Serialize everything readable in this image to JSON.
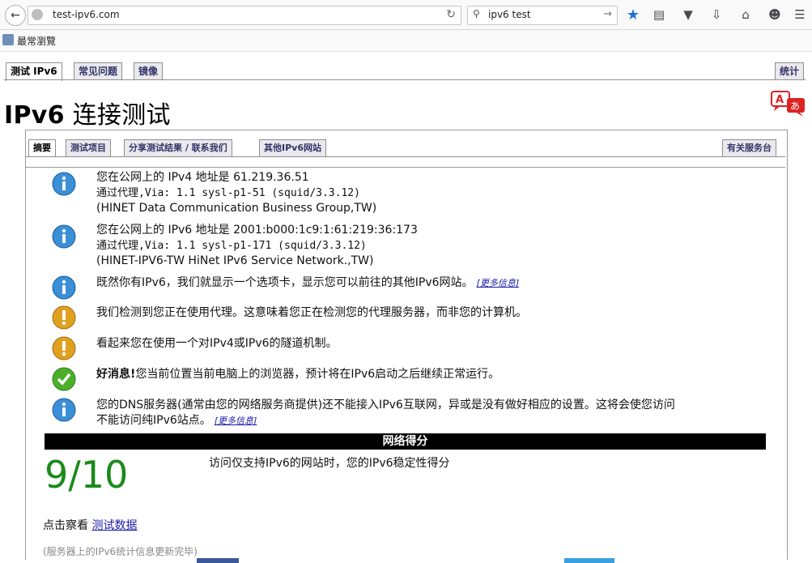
{
  "browser": {
    "url": "test-ipv6.com",
    "search_value": "ipv6 test",
    "bookmark_label": "最常瀏覽"
  },
  "page_tabs": [
    "测试 IPv6",
    "常见问题",
    "镜像"
  ],
  "stats_tab": "统计",
  "title": {
    "bold": "IPv6",
    "rest": " 连接测试"
  },
  "inner_tabs": [
    "摘要",
    "测试项目",
    "分享测试结果 / 联系我们",
    "其他IPv6网站"
  ],
  "service_tab": "有关服务台",
  "results": [
    {
      "icon": "info",
      "lines": [
        "您在公网上的 IPv4 地址是 61.219.36.51",
        "通过代理,Via: 1.1 sysl-p1-51 (squid/3.3.12)",
        "(HINET Data Communication Business Group,TW)"
      ]
    },
    {
      "icon": "info",
      "lines": [
        "您在公网上的 IPv6 地址是 2001:b000:1c9:1:61:219:36:173",
        "通过代理,Via: 1.1 sysl-p1-171 (squid/3.3.12)",
        "(HINET-IPV6-TW HiNet IPv6 Service Network.,TW)"
      ]
    },
    {
      "icon": "info",
      "text": "既然你有IPv6，我们就显示一个选项卡，显示您可以前往的其他IPv6网站。",
      "more": "[更多信息]"
    },
    {
      "icon": "warning",
      "text": "我们检测到您正在使用代理。这意味着您正在检测您的代理服务器，而非您的计算机。"
    },
    {
      "icon": "warning",
      "text": "看起来您在使用一个对IPv4或IPv6的隧道机制。"
    },
    {
      "icon": "ok",
      "bold": "好消息!",
      "text": "您当前位置当前电脑上的浏览器，预计将在IPv6启动之后继续正常运行。"
    },
    {
      "icon": "info",
      "lines": [
        "您的DNS服务器(通常由您的网络服务商提供)还不能接入IPv6互联网，异或是没有做好相应的设置。这将会使您访问",
        "不能访问纯IPv6站点。"
      ],
      "more": "[更多信息]"
    }
  ],
  "score_header": "网络得分",
  "score": "9/10",
  "score_desc": "访问仅支持IPv6的网站时，您的IPv6稳定性得分",
  "detail_prefix": "点击察看 ",
  "detail_link": "测试数据",
  "footer_note": "(服务器上的IPv6统计信息更新完毕)",
  "colors": {
    "info": "#3a8fd6",
    "warning": "#e0a020",
    "ok": "#4caf2a",
    "score": "#1b8a1b",
    "tab_text": "#333366"
  }
}
